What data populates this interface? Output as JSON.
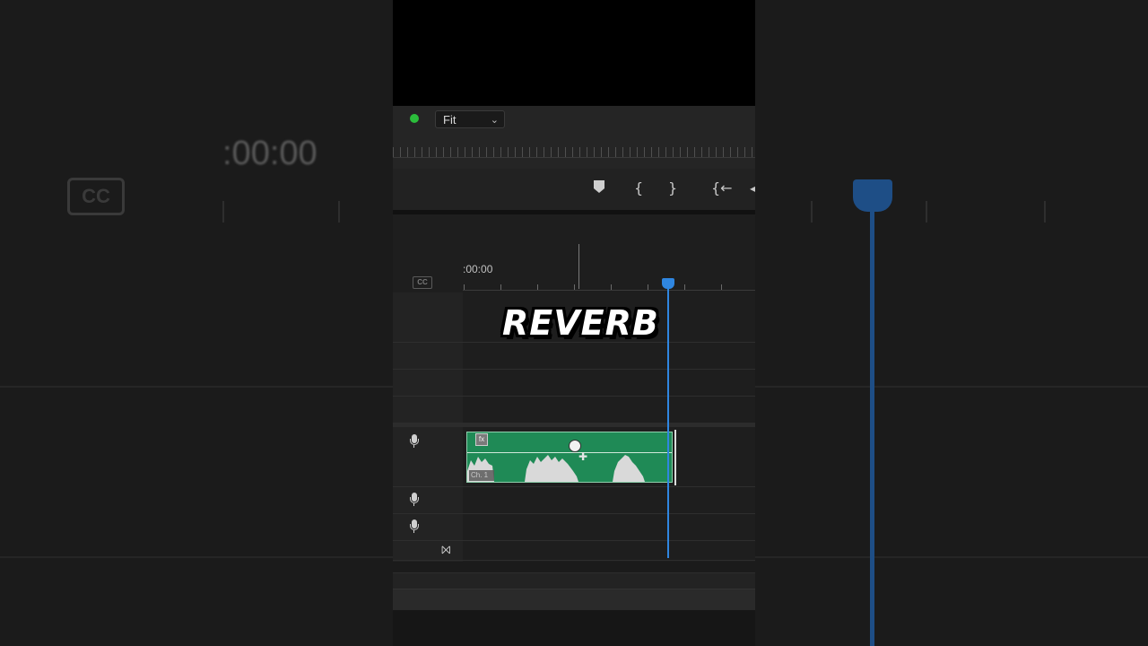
{
  "background": {
    "timecode": ":00:00",
    "cc_label": "CC"
  },
  "monitor": {
    "zoom_select": {
      "value": "Fit"
    },
    "status_color": "#2bbd3b"
  },
  "transport": {
    "buttons": [
      {
        "name": "add-marker-button",
        "glyph": "⯂"
      },
      {
        "name": "mark-in-button",
        "glyph": "{"
      },
      {
        "name": "mark-out-button",
        "glyph": "}"
      },
      {
        "name": "go-to-in-button",
        "glyph": "{←"
      },
      {
        "name": "step-back-button",
        "glyph": "◂"
      }
    ]
  },
  "timeline": {
    "timecode": ":00:00",
    "cc_label": "CC",
    "playhead_color": "#2f86e0",
    "clip": {
      "color": "#1f8a56",
      "fx_label": "fx",
      "channel_label": "Ch. 1"
    },
    "track_icons": [
      "mic-icon",
      "mic-icon",
      "mic-icon",
      "bowtie-icon"
    ]
  },
  "caption": {
    "text": "REVERB"
  }
}
